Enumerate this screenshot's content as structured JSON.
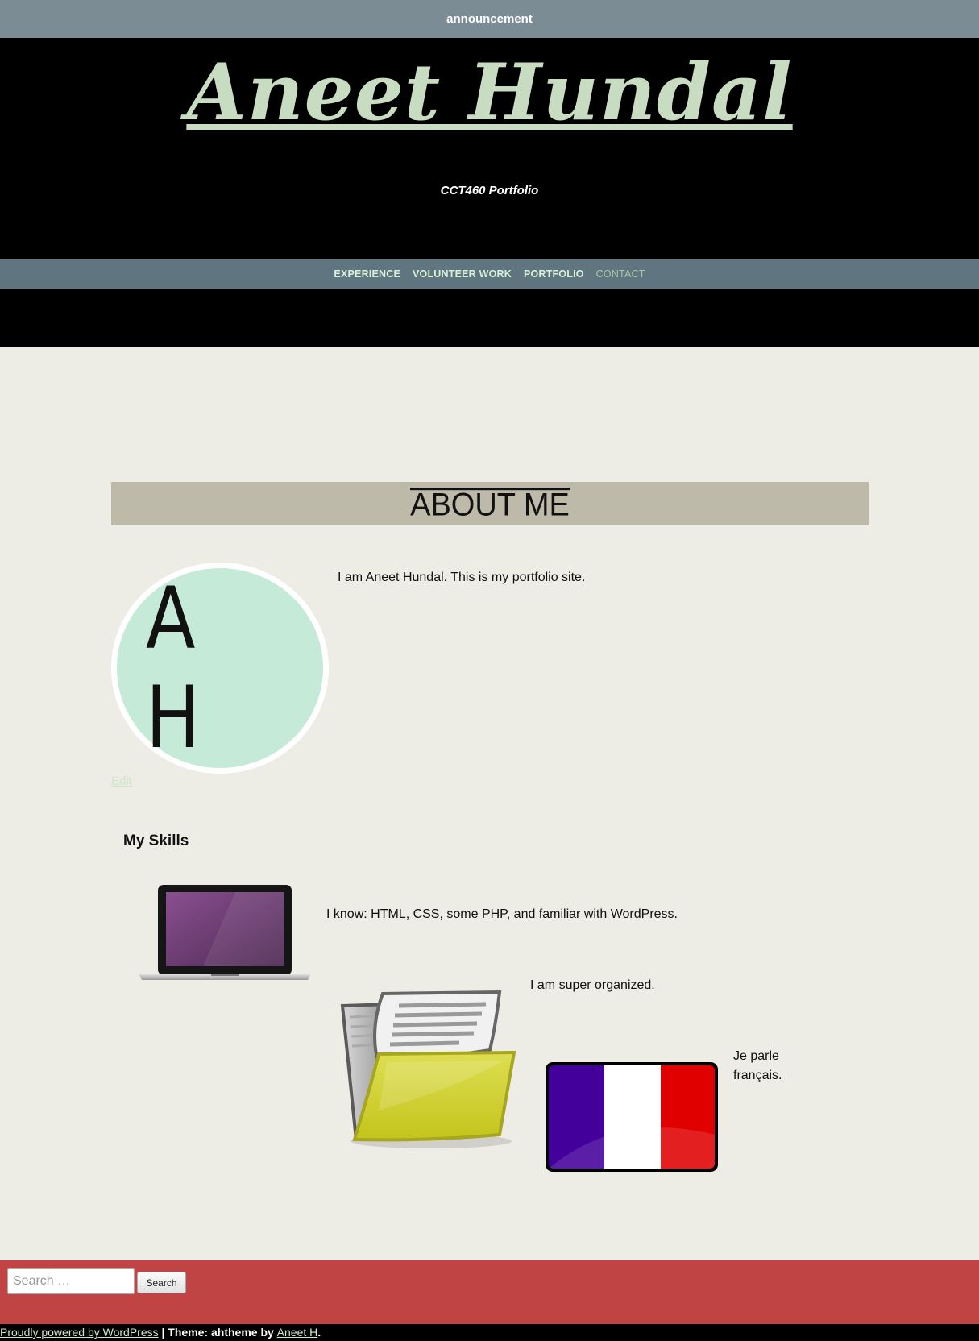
{
  "announcement": {
    "text": "announcement"
  },
  "header": {
    "site_title": "Aneet Hundal",
    "tagline": "CCT460 Portfolio",
    "accent_color": "#c8dcc2"
  },
  "nav": {
    "items": [
      {
        "label": "EXPERIENCE",
        "current": false
      },
      {
        "label": "VOLUNTEER WORK",
        "current": false
      },
      {
        "label": "PORTFOLIO",
        "current": false
      },
      {
        "label": "CONTACT",
        "current": true
      }
    ]
  },
  "about": {
    "title": "ABOUT ME",
    "avatar_initials": "A H",
    "intro": "I am Aneet Hundal. This is my portfolio site.",
    "edit_label": "Edit"
  },
  "skills": {
    "heading": "My Skills",
    "items": [
      {
        "icon": "laptop-icon",
        "text": "I know: HTML, CSS, some PHP, and familiar with WordPress."
      },
      {
        "icon": "folder-icon",
        "text": "I am super organized."
      },
      {
        "icon": "france-flag-icon",
        "text": "Je parle français."
      }
    ]
  },
  "footer": {
    "search_placeholder": "Search …",
    "search_button": "Search",
    "powered_by": "Proudly powered by WordPress",
    "separator": " | Theme: ahtheme by ",
    "author": "Aneet H",
    "end": "."
  },
  "colors": {
    "announcement_bg": "#7b8c94",
    "nav_bg": "#5f7580",
    "page_bg": "#edece5",
    "about_bar": "#bdbaa9",
    "avatar": "#c5ead7",
    "footer_bg": "#c04444"
  }
}
